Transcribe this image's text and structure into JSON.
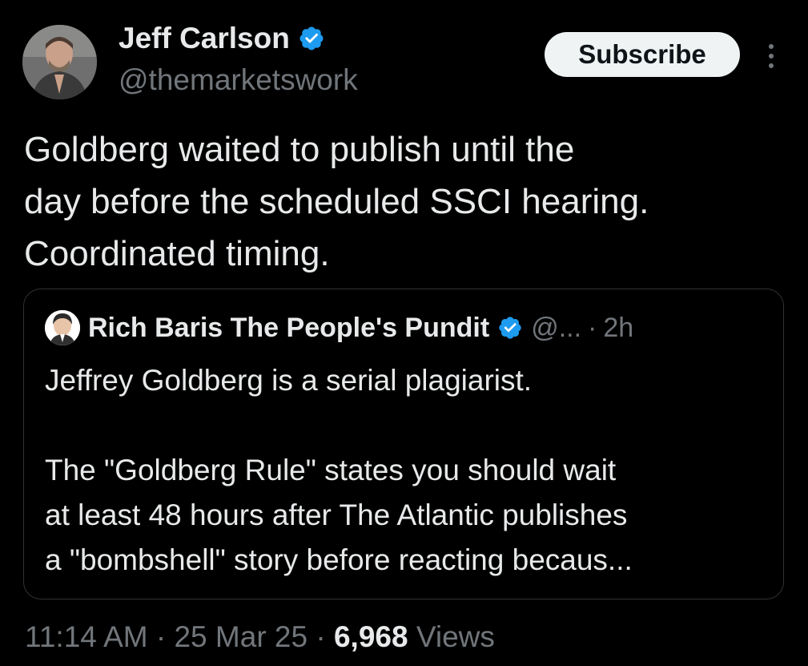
{
  "author": {
    "name": "Jeff Carlson",
    "handle": "@themarketswork",
    "verified_icon": "verified-badge-icon",
    "avatar_icon": "avatar-photo"
  },
  "actions": {
    "subscribe_label": "Subscribe",
    "more_icon": "more-vertical-icon"
  },
  "tweet": {
    "lines": [
      "Goldberg waited to publish until the",
      "day before the scheduled SSCI hearing.",
      "Coordinated timing."
    ]
  },
  "quote": {
    "author_name": "Rich Baris The People's Pundit",
    "handle": "@...",
    "separator": "·",
    "time": "2h",
    "paragraph1": "Jeffrey Goldberg is a serial plagiarist.",
    "paragraph2_lines": [
      "The \"Goldberg Rule\" states you should wait",
      "at least 48 hours after The Atlantic publishes",
      "a \"bombshell\" story before reacting becaus..."
    ]
  },
  "meta": {
    "time": "11:14 AM",
    "separator": "·",
    "date": "25 Mar 25",
    "views_count": "6,968",
    "views_label": "Views"
  },
  "colors": {
    "background": "#000000",
    "text_primary": "#e7e9ea",
    "text_secondary": "#71767b",
    "verified_blue": "#1d9bf0",
    "border": "#2f3336",
    "button_bg": "#eff3f4"
  }
}
